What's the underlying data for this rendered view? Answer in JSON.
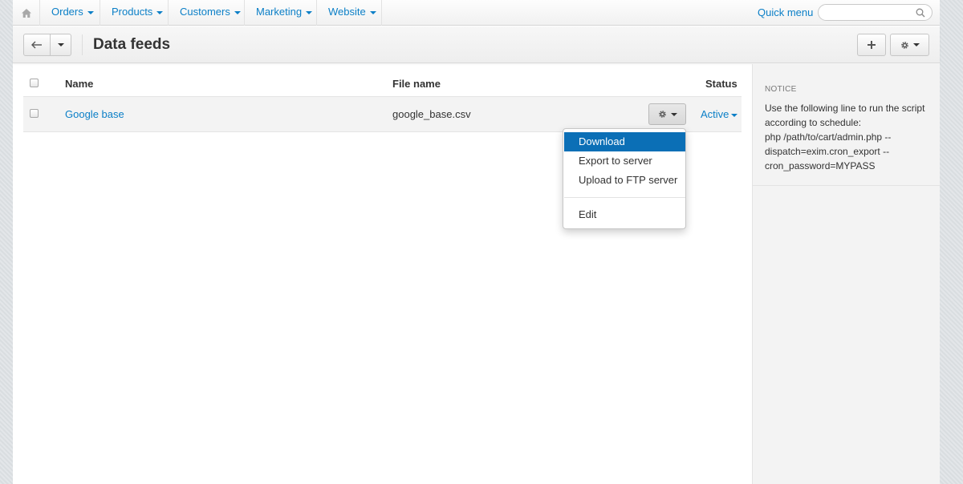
{
  "nav": {
    "home_icon": "home-icon",
    "items": [
      {
        "label": "Orders"
      },
      {
        "label": "Products"
      },
      {
        "label": "Customers"
      },
      {
        "label": "Marketing"
      },
      {
        "label": "Website"
      }
    ],
    "quick_menu_label": "Quick menu",
    "search": {
      "placeholder": "",
      "value": "",
      "icon": "search-icon"
    }
  },
  "header": {
    "title": "Data feeds",
    "back_icon": "back-arrow-icon",
    "add_icon": "plus-icon",
    "settings_icon": "gear-icon"
  },
  "table": {
    "columns": {
      "name": "Name",
      "file_name": "File name",
      "status": "Status"
    },
    "rows": [
      {
        "name": "Google base",
        "file_name": "google_base.csv",
        "status": "Active"
      }
    ]
  },
  "dropdown": {
    "items": [
      {
        "label": "Download",
        "active": true
      },
      {
        "label": "Export to server",
        "active": false
      },
      {
        "label": "Upload to FTP server",
        "active": false
      },
      {
        "label": "Edit",
        "active": false
      }
    ]
  },
  "sidebar": {
    "notice_title": "NOTICE",
    "notice_lines": [
      "Use the following line to run the script according to schedule:",
      "php /path/to/cart/admin.php --dispatch=exim.cron_export --cron_password=MYPASS"
    ]
  },
  "colors": {
    "link": "#0b7fc7",
    "selected_menu_bg": "#0b6fb6"
  }
}
